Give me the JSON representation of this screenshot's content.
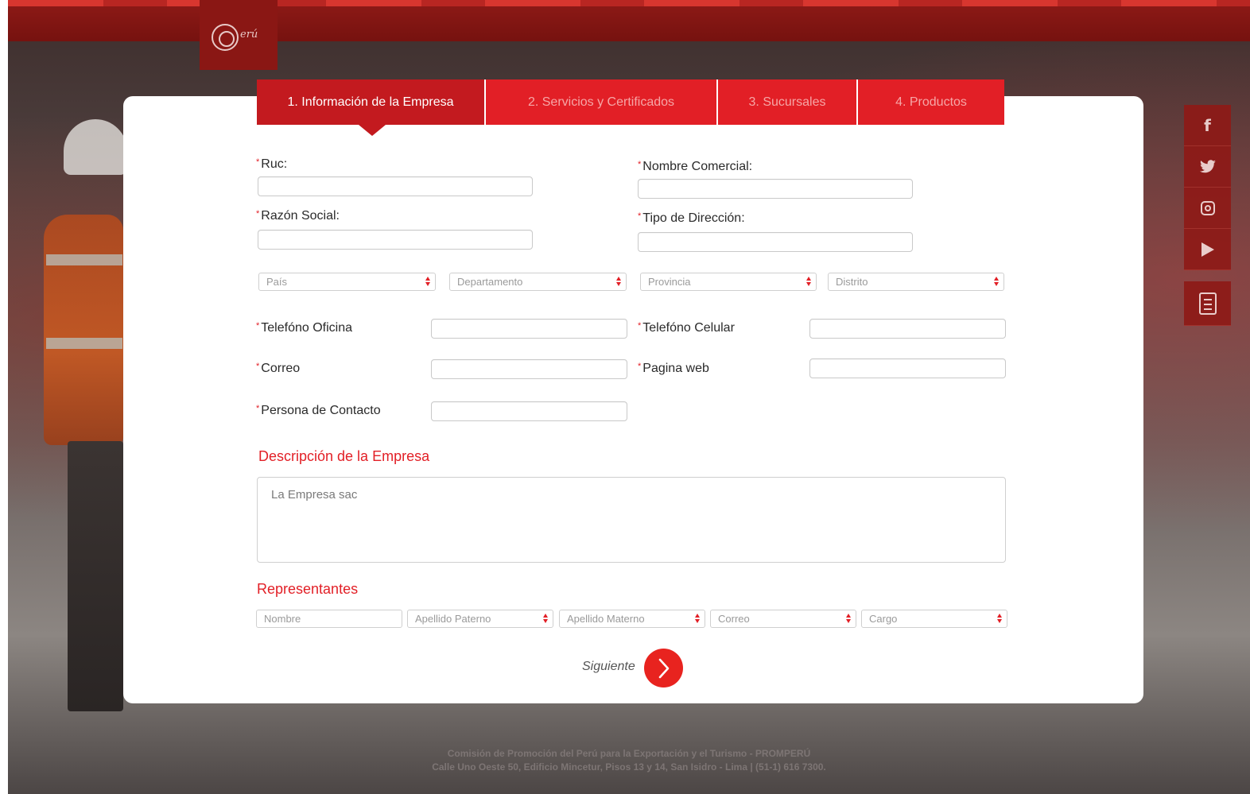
{
  "header": {
    "logo_text": "erú"
  },
  "tabs": [
    {
      "label": "1. Información de la Empresa",
      "active": true
    },
    {
      "label": "2. Servicios y Certificados",
      "active": false
    },
    {
      "label": "3. Sucursales",
      "active": false
    },
    {
      "label": "4. Productos",
      "active": false
    }
  ],
  "form": {
    "required_mark": "*",
    "ruc_label": "Ruc:",
    "ruc_value": "",
    "nombre_comercial_label": "Nombre Comercial:",
    "nombre_comercial_value": "",
    "razon_social_label": "Razón Social:",
    "razon_social_value": "",
    "tipo_direccion_label": "Tipo de Dirección:",
    "tipo_direccion_value": "",
    "pais_select": "País",
    "departamento_select": "Departamento",
    "provincia_select": "Provincia",
    "distrito_select": "Distrito",
    "telefono_oficina_label": "Telefóno Oficina",
    "telefono_celular_label": "Telefóno Celular",
    "correo_label": "Correo",
    "pagina_web_label": "Pagina web",
    "persona_contacto_label": "Persona de Contacto"
  },
  "descripcion": {
    "title": "Descripción  de la Empresa",
    "value": "La Empresa sac"
  },
  "representantes": {
    "title": "Representantes",
    "nombre_placeholder": "Nombre",
    "apellido_paterno_select": "Apellido Paterno",
    "apellido_materno_select": "Apellido Materno",
    "correo_select": "Correo",
    "cargo_select": "Cargo"
  },
  "actions": {
    "next_label": "Siguiente"
  },
  "social": {
    "facebook": "f"
  },
  "footer": {
    "line1": "Comisión de Promoción del Perú para la Exportación y el Turismo - PROMPERÚ",
    "line2": "Calle Uno Oeste 50, Edificio Mincetur, Pisos 13 y 14, San Isidro - Lima | (51-1) 616 7300."
  },
  "colors": {
    "brand_red": "#e21f26",
    "active_tab": "#c31a1f",
    "header_dark_red": "#76120f"
  }
}
